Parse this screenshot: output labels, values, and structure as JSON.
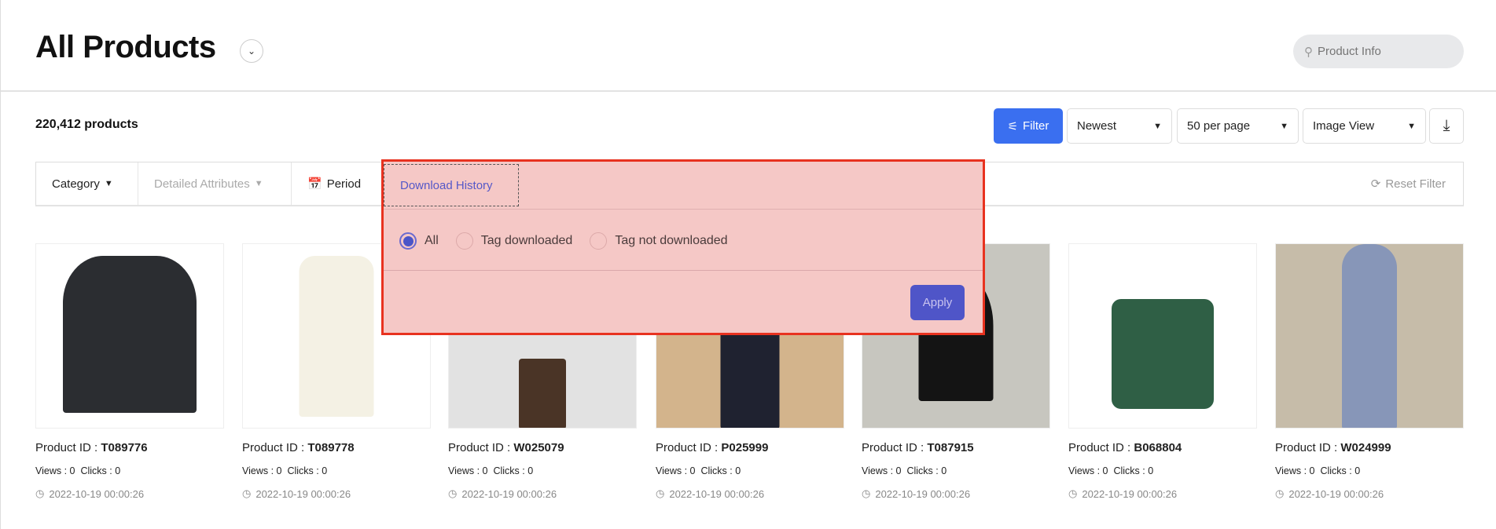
{
  "header": {
    "title": "All Products",
    "search_placeholder": "Product Info"
  },
  "toolbar": {
    "count": "220,412 products",
    "filter_label": "Filter",
    "sort": "Newest",
    "per_page": "50 per page",
    "view": "Image View"
  },
  "filter_bar": {
    "category": "Category",
    "detailed_attributes": "Detailed Attributes",
    "period": "Period",
    "download_history": "Download History",
    "reset": "Reset Filter"
  },
  "download_history_panel": {
    "options": [
      "All",
      "Tag downloaded",
      "Tag not downloaded"
    ],
    "selected": "All",
    "apply": "Apply"
  },
  "colors": {
    "accent": "#3a6ff0",
    "apply": "#4f55c8",
    "highlight_border": "#e8321f"
  },
  "products": [
    {
      "id_label": "Product ID :",
      "id": "T089776",
      "views": "Views : 0",
      "clicks": "Clicks : 0",
      "date": "2022-10-19 00:00:26"
    },
    {
      "id_label": "Product ID :",
      "id": "T089778",
      "views": "Views : 0",
      "clicks": "Clicks : 0",
      "date": "2022-10-19 00:00:26"
    },
    {
      "id_label": "Product ID :",
      "id": "W025079",
      "views": "Views : 0",
      "clicks": "Clicks : 0",
      "date": "2022-10-19 00:00:26"
    },
    {
      "id_label": "Product ID :",
      "id": "P025999",
      "views": "Views : 0",
      "clicks": "Clicks : 0",
      "date": "2022-10-19 00:00:26"
    },
    {
      "id_label": "Product ID :",
      "id": "T087915",
      "views": "Views : 0",
      "clicks": "Clicks : 0",
      "date": "2022-10-19 00:00:26"
    },
    {
      "id_label": "Product ID :",
      "id": "B068804",
      "views": "Views : 0",
      "clicks": "Clicks : 0",
      "date": "2022-10-19 00:00:26"
    },
    {
      "id_label": "Product ID :",
      "id": "W024999",
      "views": "Views : 0",
      "clicks": "Clicks : 0",
      "date": "2022-10-19 00:00:26"
    }
  ]
}
